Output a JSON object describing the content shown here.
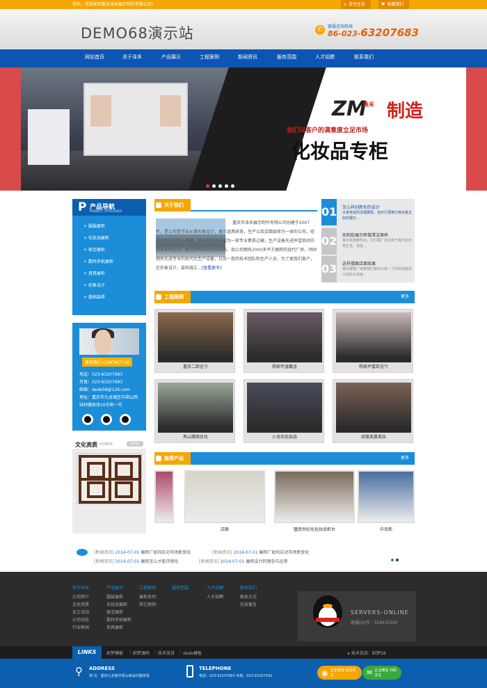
{
  "topbar": {
    "welcome": "您好，欢迎来到重庆泽禾展示制作有限公司！",
    "homepage": "设为主页",
    "favorite": "收藏我们"
  },
  "header": {
    "logo": "DEMO68演示站",
    "hotline_label": "客服咨询热线",
    "hotline_prefix": "86-023-",
    "hotline_number": "63207683"
  },
  "nav": [
    "网站首页",
    "关于泽禾",
    "产品展示",
    "工程案例",
    "新闻资讯",
    "服务范围",
    "人才招聘",
    "联系我们"
  ],
  "banner": {
    "brand": "ZM",
    "brand_cn": "泽禾",
    "headline_red": "制造",
    "slogan": "我们以客户的满意度立足市场",
    "title": "化妆品专柜",
    "dots": 5,
    "active_dot": 1
  },
  "products_nav": {
    "letter": "P",
    "title": "产品导航",
    "subtitle": "PRODUCT CATEGORIES",
    "items": [
      "+ 服装展柜",
      "+ 化妆品展柜",
      "+ 珠宝展柜",
      "+ 数码手机展柜",
      "+ 资具展柜",
      "+ 形象设计",
      "+ 基础装修"
    ]
  },
  "contact": {
    "label": "联系我们  CONTACT US",
    "lines": [
      "电话：023-63207683",
      "传真：023-63207693",
      "邮箱：dede58@126.com",
      "地址：重庆市九龙坡区中梁山西",
      "站村路体场16号附一号"
    ]
  },
  "culture": {
    "title": "文化资质",
    "subtitle": "HONOR",
    "more": "MORE"
  },
  "about": {
    "tag": "关于我们",
    "text": "重庆市泽禾展示制作有限公司创建于2007年，是公司是专业从事形象设计，展示道具研发，生产以及店面装修为一体的公司，经过多年的实践与发展，该公司如今以成为一家专业素质过硬，生产设备先进声望良好的行业知名企业；经过多年的努力与实践，现公司拥有2000多平方面积的现代厂房，同时拥有先进专业的现代化生产设备，以及一批的技术团队和生产人员，为了更我们客户，在形象设计，装饰施工...",
    "more": "[查看更多]"
  },
  "news": [
    {
      "num": "01",
      "title": "怎么样创新形的设计",
      "desc": "大家常说的清理展柜，但外行很难分辨出真正好的展示..."
    },
    {
      "num": "02",
      "title": "如何给展示柜做清洁保养",
      "desc": "展示柜随着时间，它们展厂还往有于我们的日常生活，但是..."
    },
    {
      "num": "03",
      "title": "这样摆面店面效果",
      "desc": "展示展柜厂家教我们摆出大家一个好的店面设计是好么店面..."
    }
  ],
  "cases": {
    "tag": "工程案例",
    "more": "更多",
    "items": [
      {
        "caption": "重庆二郎吉兮",
        "color": "#8b6a4f"
      },
      {
        "caption": "杨家坪温馨金",
        "color": "#6b5a66"
      },
      {
        "caption": "杨家坪富若吉兮",
        "color": "#c9b8b8"
      },
      {
        "caption": "秀山雅丽日化",
        "color": "#9aa79a"
      },
      {
        "caption": "小龙坎化妆品",
        "color": "#4a4d5a"
      },
      {
        "caption": "武隆美晨美妆",
        "color": "#7a6256"
      }
    ]
  },
  "recommended": {
    "tag": "推荐产品",
    "more": "更多",
    "items": [
      {
        "caption": "",
        "color": "#b04a6a"
      },
      {
        "caption": "店面",
        "color": "#d8d3c8"
      },
      {
        "caption": "璧南世纪化化妆品柜台",
        "color": "#7a6a5a"
      },
      {
        "caption": "中岛柜",
        "color": "#4a6ea0"
      }
    ]
  },
  "ticker": [
    {
      "cat": "[新闻资讯]",
      "date": "2014-07-01",
      "title": "展柜厂如何应对市场新变化"
    },
    {
      "cat": "[新闻资讯]",
      "date": "2014-07-01",
      "title": "展柜厂如何应对市场新变化"
    },
    {
      "cat": "[新闻资讯]",
      "date": "2014-07-01",
      "title": "展柜怎么才能环保化"
    },
    {
      "cat": "[新闻资讯]",
      "date": "2014-07-01",
      "title": "展柜设计的理念与运用"
    }
  ],
  "footer": {
    "cols": [
      {
        "title": "关于泽禾",
        "items": [
          "公司简介",
          "文化资质",
          "员工活动",
          "公司动态",
          "行业新闻"
        ]
      },
      {
        "title": "产品展示",
        "items": [
          "服装展柜",
          "化妆品展柜",
          "珠宝展柜",
          "数码手机展柜",
          "资具展柜"
        ]
      },
      {
        "title": "工程案例",
        "items": [
          "展柜系列",
          "其它案例"
        ]
      },
      {
        "title": "服务范围",
        "items": []
      },
      {
        "title": "人才招聘",
        "items": [
          "人才招聘"
        ]
      },
      {
        "title": "联系我们",
        "items": [
          "联系方式",
          "在线留言"
        ]
      }
    ],
    "servers": "SERVERS-ONLINE",
    "qq": "客服QQ号：329435595"
  },
  "links": {
    "label": "LINKS",
    "items": [
      "织梦模板",
      "织梦源码",
      "技术支持",
      "dede模板"
    ],
    "support": "技术支持：织梦58"
  },
  "bottom": {
    "address_title": "ADDRESS",
    "address": "地 址：重庆九龙坡中梁山西站村路体场",
    "phone_title": "TELEPHONE",
    "phone": "电话：023-63207683  传真：023-63207593",
    "qq_pill": "企业微博 欢迎关注",
    "wx_pill": "企业微信 扫码关注"
  },
  "colors": {
    "orange": "#f6a600",
    "blue": "#1b8dd9",
    "navy": "#0b5fae"
  }
}
